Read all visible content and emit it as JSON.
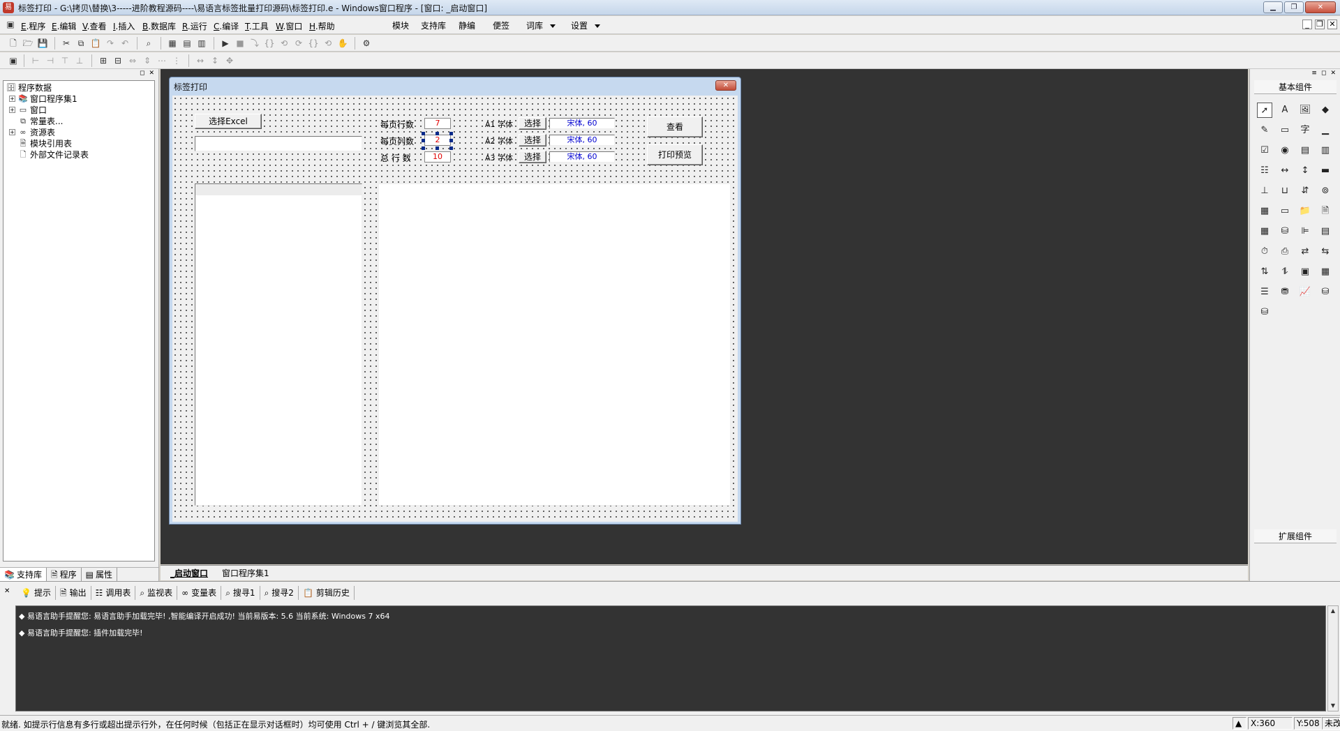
{
  "window": {
    "title": "标签打印 - G:\\拷贝\\替换\\3-----进阶教程源码----\\易语言标签批量打印源码\\标签打印.e - Windows窗口程序 - [窗口: _启动窗口]",
    "app_icon_glyph": "易"
  },
  "menu": {
    "items": [
      {
        "key": "E",
        "label": ".程序"
      },
      {
        "key": "E",
        "label": ".编辑"
      },
      {
        "key": "V",
        "label": ".查看"
      },
      {
        "key": "I",
        "label": ".插入"
      },
      {
        "key": "B",
        "label": ".数据库"
      },
      {
        "key": "R",
        "label": ".运行"
      },
      {
        "key": "C",
        "label": ".编译"
      },
      {
        "key": "T",
        "label": ".工具"
      },
      {
        "key": "W",
        "label": ".窗口"
      },
      {
        "key": "H",
        "label": ".帮助"
      }
    ],
    "extras": [
      "模块",
      "支持库",
      "静编",
      "便签",
      "词库",
      "设置"
    ]
  },
  "left_panel": {
    "tree": [
      {
        "label": "程序数据",
        "icon": "database-icon"
      },
      {
        "label": "窗口程序集1",
        "icon": "module-icon"
      },
      {
        "label": "窗口",
        "icon": "window-icon"
      },
      {
        "label": "常量表...",
        "icon": "constant-icon"
      },
      {
        "label": "资源表",
        "icon": "resource-icon"
      },
      {
        "label": "模块引用表",
        "icon": "module-ref-icon"
      },
      {
        "label": "外部文件记录表",
        "icon": "file-icon"
      }
    ],
    "tabs": [
      "支持库",
      "程序",
      "属性"
    ]
  },
  "designer": {
    "title": "标签打印",
    "select_excel_label": "选择Excel",
    "rows_per_page_label": "每页行数",
    "cols_per_page_label": "每页列数",
    "total_rows_label": "总 行 数",
    "rows_per_page": "7",
    "cols_per_page": "2",
    "total_rows": "10",
    "font_rows": [
      {
        "label": "A1 字体",
        "button": "选择",
        "value": "宋体, 60"
      },
      {
        "label": "A2 字体",
        "button": "选择",
        "value": "宋体, 60"
      },
      {
        "label": "A3 字体",
        "button": "选择",
        "value": "宋体, 60"
      }
    ],
    "view_button": "查看",
    "print_preview_button": "打印预览"
  },
  "right_panel": {
    "title": "基本组件",
    "footer": "扩展组件"
  },
  "doc_tabs": [
    "_启动窗口",
    "窗口程序集1"
  ],
  "bottom_panel": {
    "tabs": [
      "提示",
      "输出",
      "调用表",
      "监视表",
      "变量表",
      "搜寻1",
      "搜寻2",
      "剪辑历史"
    ],
    "lines": [
      "◆ 易语言助手提醒您: 易语言助手加载完毕! ,智能编译开启成功! 当前易版本: 5.6 当前系统: Windows 7 x64",
      "◆ 易语言助手提醒您: 插件加载完毕!"
    ]
  },
  "status": {
    "text": "就绪. 如提示行信息有多行或超出提示行外，在任何时候（包括正在显示对话框时）均可使用 Ctrl + / 键浏览其全部.",
    "x": "X:360",
    "y": "Y:508",
    "mode": "未改"
  },
  "colors": {
    "workspace": "#333333",
    "output_bg": "#333333",
    "num_value": "#e00000",
    "font_value": "#0000d0"
  }
}
